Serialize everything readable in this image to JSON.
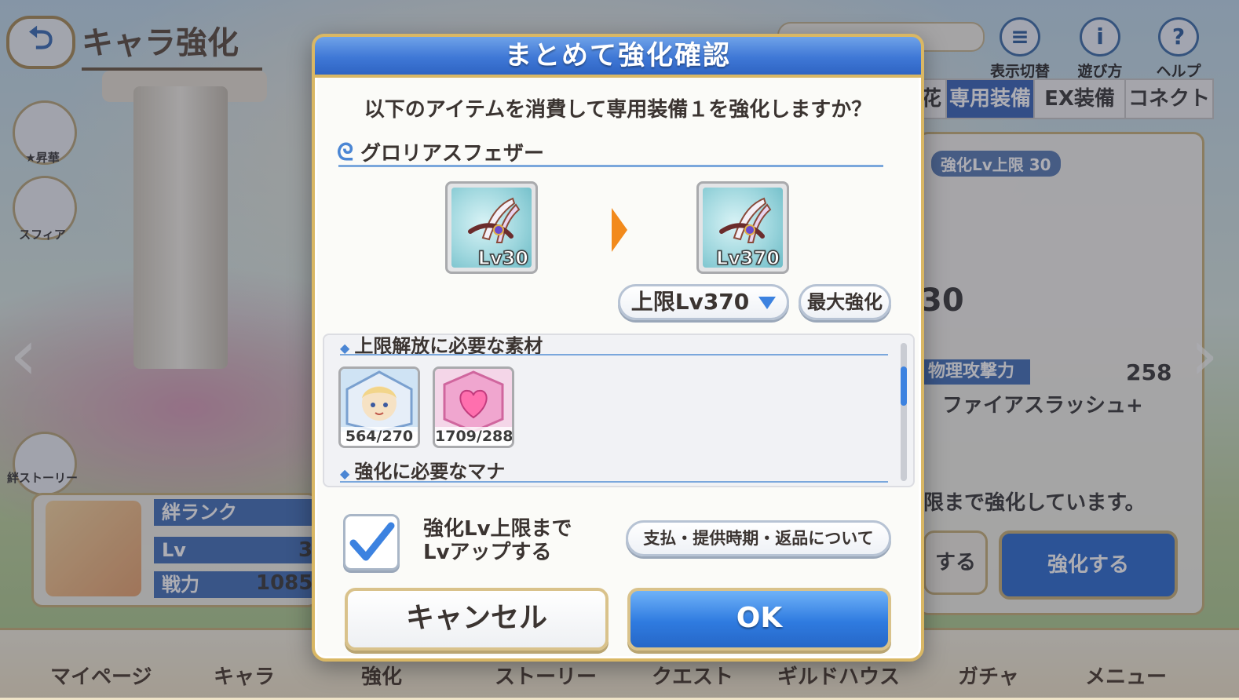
{
  "background": {
    "page_title": "キャラ強化",
    "back_label": "⮌",
    "top_icons": [
      {
        "label": "表示切替",
        "glyph": "≡"
      },
      {
        "label": "遊び方",
        "glyph": "i"
      },
      {
        "label": "ヘルプ",
        "glyph": "?"
      }
    ],
    "tabs": [
      "花",
      "専用装備",
      "EX装備",
      "コネクト"
    ],
    "side_items": [
      "★昇華",
      "スフィア",
      "絆ストーリー"
    ],
    "level_cap_badge": "強化Lv上限 30",
    "level_cap_equip_lv": "30",
    "stats": [
      {
        "label": "絆ランク",
        "value": ""
      },
      {
        "label": "Lv",
        "value": "3"
      },
      {
        "label": "戦力",
        "value": "1085"
      }
    ],
    "physical_attack_label": "物理攻撃力",
    "physical_attack_value": "258",
    "skill_name": "ファイアスラッシュ+",
    "notice": "限まで強化しています。",
    "action_buttons": [
      "する",
      "強化する"
    ],
    "nav_items": [
      "マイページ",
      "キャラ",
      "強化",
      "ストーリー",
      "クエスト",
      "ギルドハウス",
      "ガチャ",
      "メニュー"
    ]
  },
  "modal": {
    "title": "まとめて強化確認",
    "message": "以下のアイテムを消費して専用装備１を強化しますか？",
    "item_name": "グロリアスフェザー",
    "from_level": "Lv30",
    "to_level": "Lv370",
    "level_select": "上限Lv370",
    "max_button": "最大強化",
    "materials_heading": "上限解放に必要な素材",
    "materials": [
      {
        "name": "character-memory-piece",
        "count": "564/270"
      },
      {
        "name": "heart-crystal",
        "count": "1709/288"
      }
    ],
    "mana_heading": "強化に必要なマナ",
    "checkbox_checked": true,
    "checkbox_label_line1": "強化Lv上限まで",
    "checkbox_label_line2": "Lvアップする",
    "info_button": "支払・提供時期・返品について",
    "cancel_button": "キャンセル",
    "ok_button": "OK"
  },
  "colors": {
    "header_blue": "#3f78d6",
    "gold_border": "#d9b764",
    "accent_orange": "#f28a1c",
    "ok_blue": "#2f7be0"
  }
}
